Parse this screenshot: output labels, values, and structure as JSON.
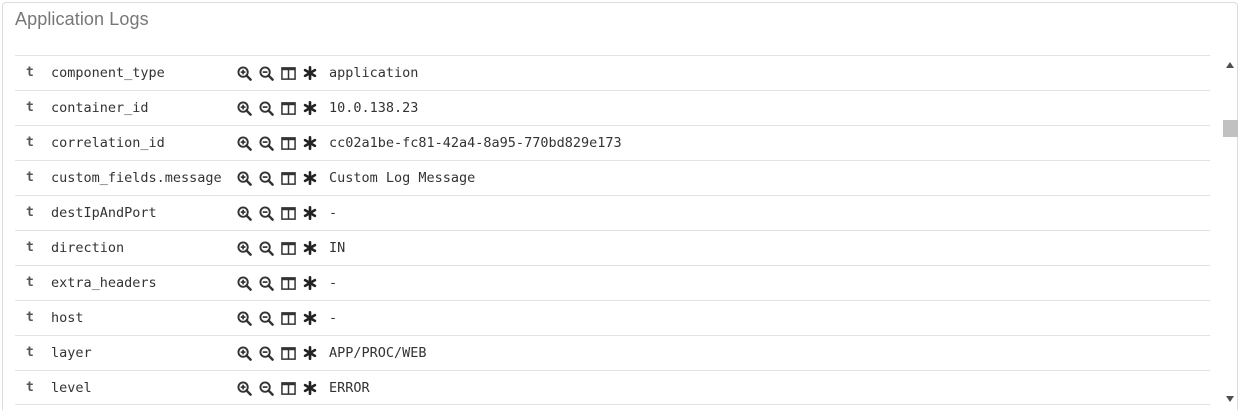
{
  "panel": {
    "title": "Application Logs"
  },
  "icons": {
    "filter_for": "zoom-in-icon",
    "filter_out": "zoom-out-icon",
    "toggle_column": "columns-icon",
    "filter_exists": "asterisk-icon"
  },
  "rows": [
    {
      "type": "t",
      "field": "component_type",
      "value": "application"
    },
    {
      "type": "t",
      "field": "container_id",
      "value": "10.0.138.23"
    },
    {
      "type": "t",
      "field": "correlation_id",
      "value": "cc02a1be-fc81-42a4-8a95-770bd829e173"
    },
    {
      "type": "t",
      "field": "custom_fields.message",
      "value": "Custom Log Message"
    },
    {
      "type": "t",
      "field": "destIpAndPort",
      "value": "-"
    },
    {
      "type": "t",
      "field": "direction",
      "value": "IN"
    },
    {
      "type": "t",
      "field": "extra_headers",
      "value": "-"
    },
    {
      "type": "t",
      "field": "host",
      "value": "-"
    },
    {
      "type": "t",
      "field": "layer",
      "value": "APP/PROC/WEB"
    },
    {
      "type": "t",
      "field": "level",
      "value": "ERROR"
    }
  ]
}
